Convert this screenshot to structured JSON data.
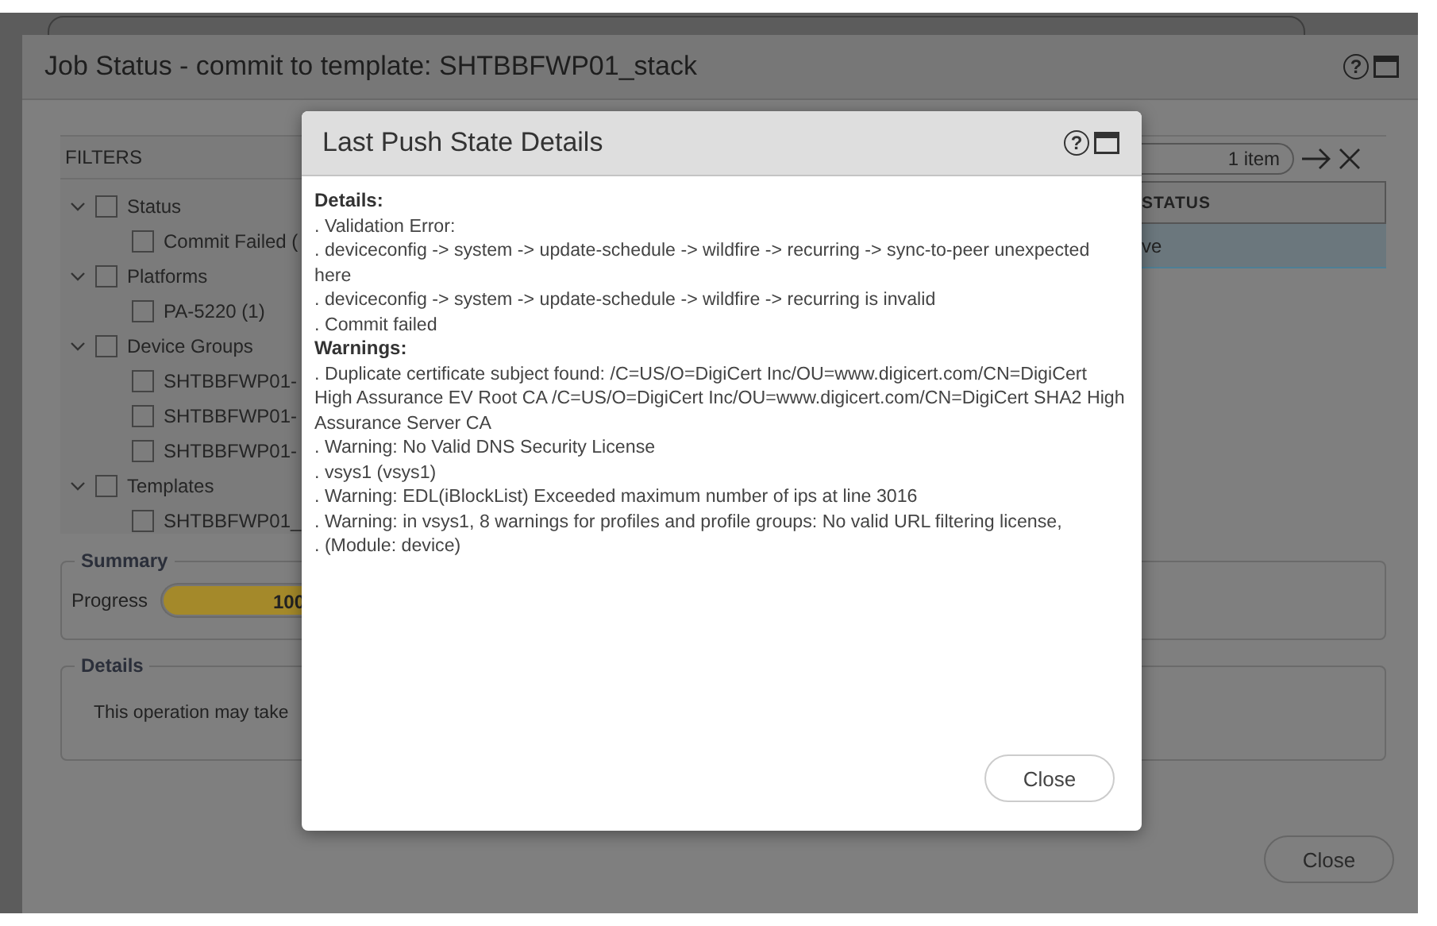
{
  "job_dialog": {
    "title": "Job Status - commit to template: SHTBBFWP01_stack",
    "help_icon": "?"
  },
  "filters": {
    "title": "FILTERS",
    "groups": [
      {
        "label": "Status",
        "expanded": true,
        "checked": false,
        "children": [
          {
            "label": "Commit Failed (",
            "checked": false
          }
        ]
      },
      {
        "label": "Platforms",
        "expanded": true,
        "checked": false,
        "children": [
          {
            "label": "PA-5220 (1)",
            "checked": false
          }
        ]
      },
      {
        "label": "Device Groups",
        "expanded": true,
        "checked": false,
        "children": [
          {
            "label": "SHTBBFWP01-",
            "checked": false
          },
          {
            "label": "SHTBBFWP01-",
            "checked": false
          },
          {
            "label": "SHTBBFWP01-",
            "checked": false
          }
        ]
      },
      {
        "label": "Templates",
        "expanded": true,
        "checked": false,
        "children": [
          {
            "label": "SHTBBFWP01_",
            "checked": false
          }
        ]
      }
    ]
  },
  "grid": {
    "count": "1 item",
    "columns": [
      "STATUS"
    ],
    "rows": [
      {
        "cells": [
          "ve"
        ],
        "selected": true
      }
    ]
  },
  "summary": {
    "legend": "Summary",
    "progress_label": "Progress",
    "progress_text": "100",
    "level": 1
  },
  "details": {
    "legend": "Details",
    "text": "This operation may take"
  },
  "close_button": "Close",
  "modal": {
    "title": "Last Push State Details",
    "help_icon": "?",
    "sections": [
      {
        "heading": "Details:",
        "lines": [
          ". Validation Error:",
          ". deviceconfig -> system -> update-schedule -> wildfire -> recurring -> sync-to-peer unexpected here",
          ". deviceconfig -> system -> update-schedule -> wildfire -> recurring is invalid",
          ". Commit failed"
        ]
      },
      {
        "heading": "Warnings:",
        "lines": [
          ". Duplicate certificate subject found: /C=US/O=DigiCert Inc/OU=www.digicert.com/CN=DigiCert High Assurance EV Root CA /C=US/O=DigiCert Inc/OU=www.digicert.com/CN=DigiCert SHA2 High Assurance Server CA",
          ". Warning: No Valid DNS Security License",
          ". vsys1 (vsys1)",
          ". Warning: EDL(iBlockList) Exceeded maximum number of ips at line 3016",
          ". Warning: in vsys1, 8 warnings for profiles and profile groups: No valid URL filtering license,",
          ". (Module: device)"
        ]
      }
    ],
    "close_button": "Close"
  }
}
